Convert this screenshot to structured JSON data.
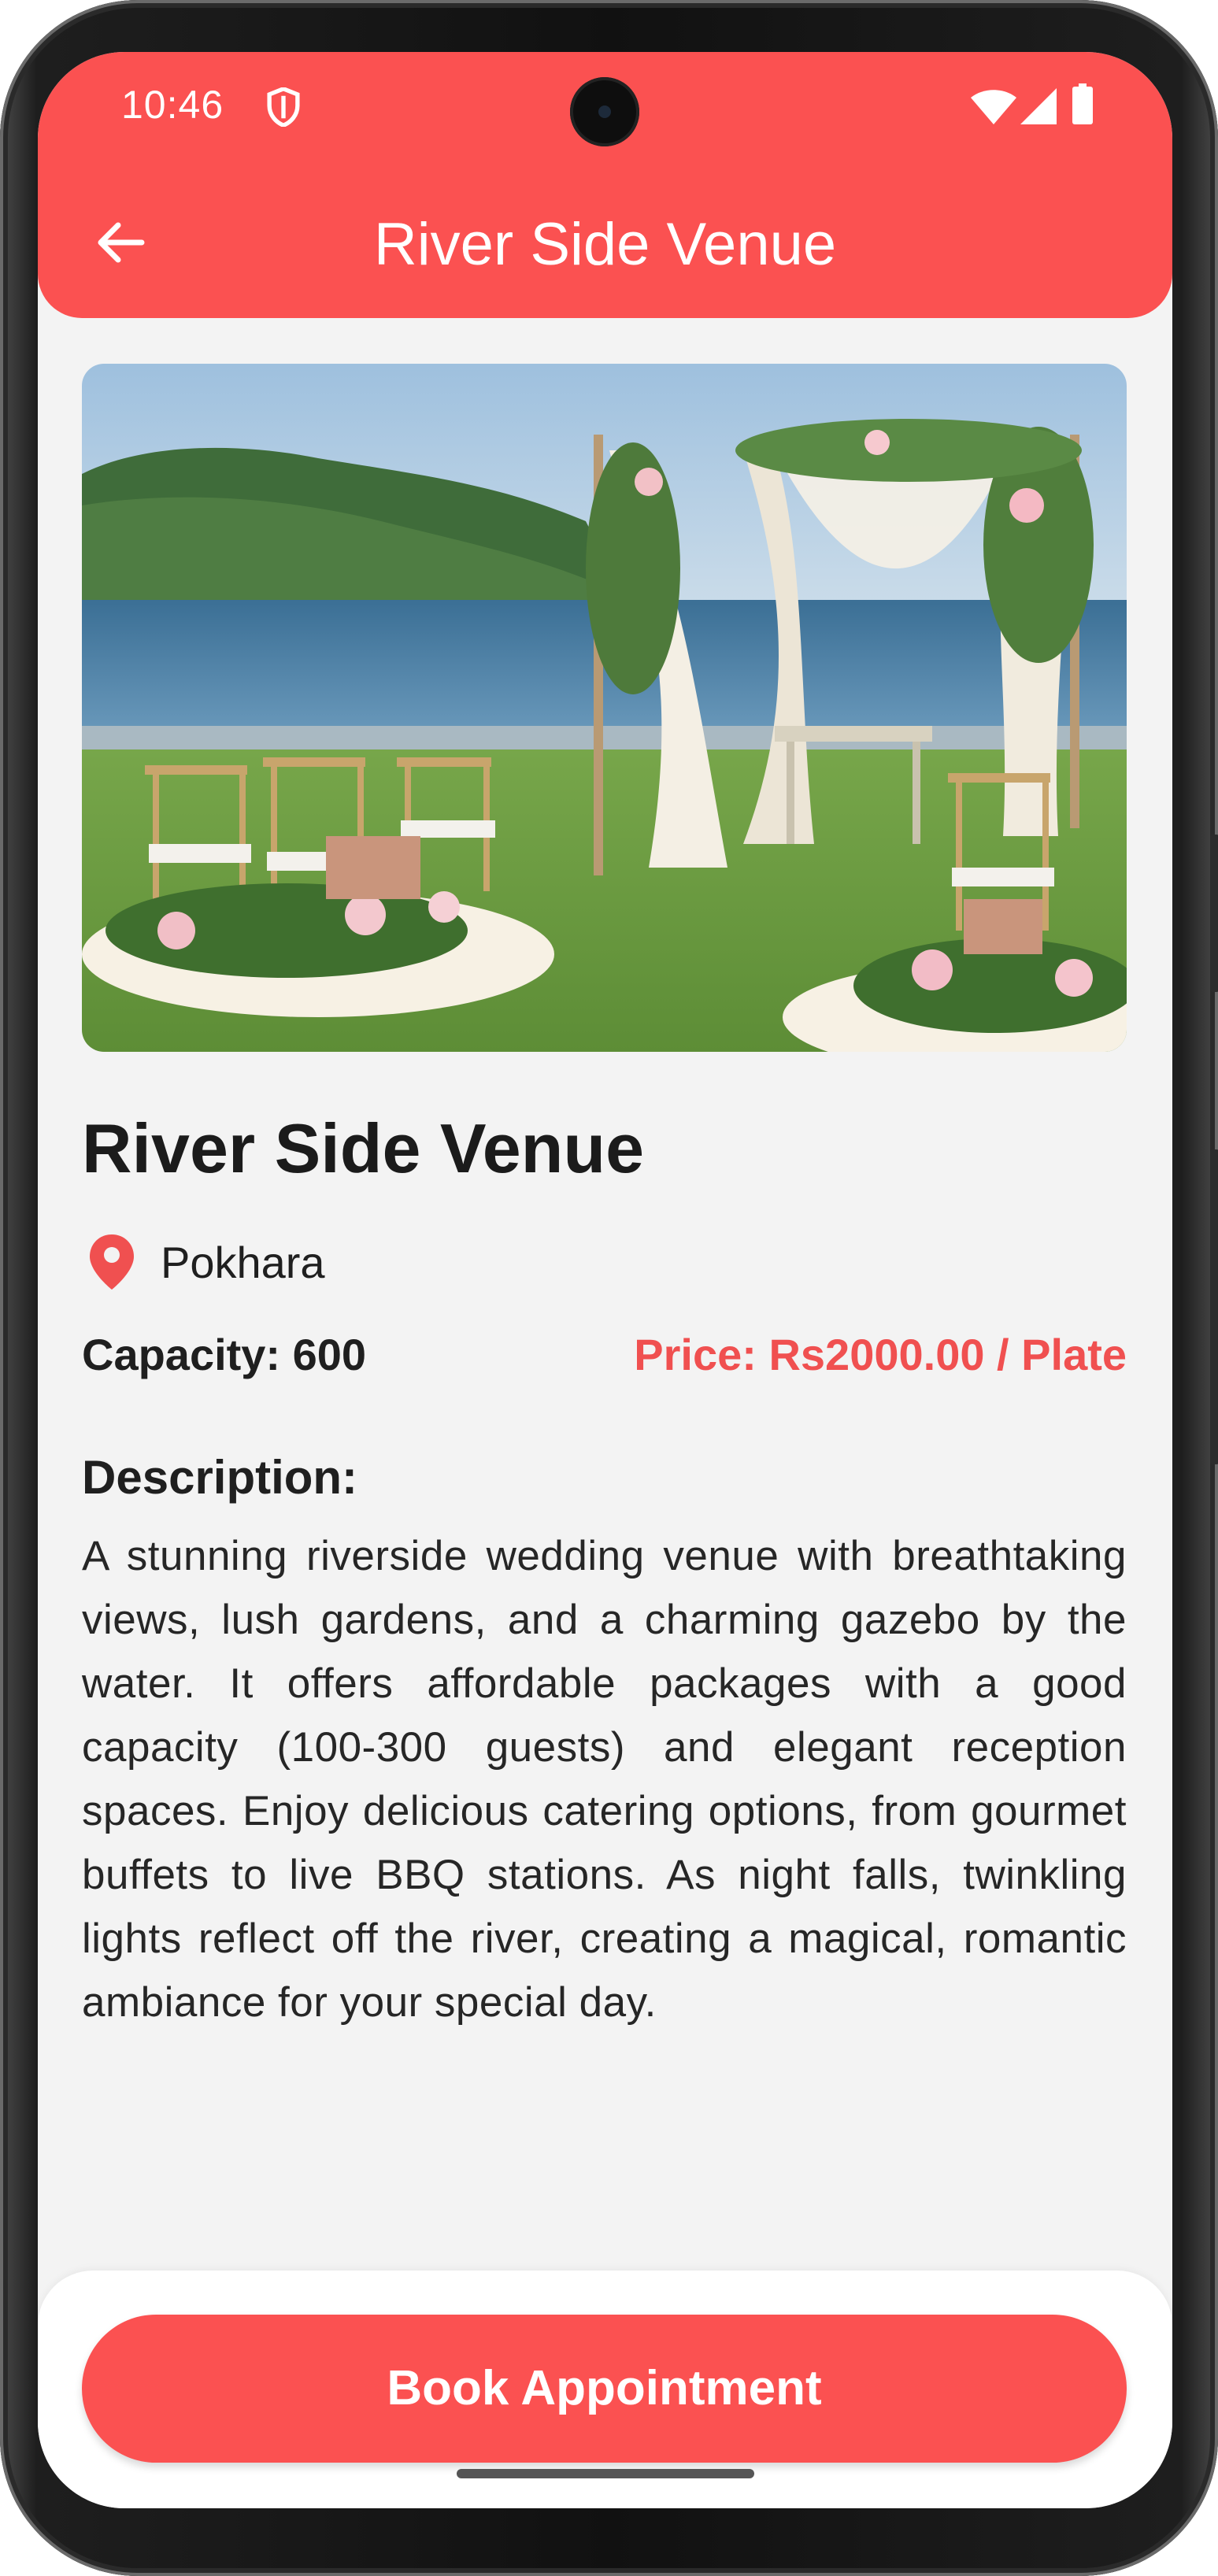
{
  "status_bar": {
    "time": "10:46",
    "icons": [
      "shield-icon",
      "wifi-icon",
      "signal-icon",
      "battery-icon"
    ]
  },
  "app_bar": {
    "title": "River Side Venue",
    "back_icon": "arrow-left-icon",
    "color": "#fb5151"
  },
  "venue": {
    "image_alt": "Outdoor wedding gazebo with white drapes and flowers by the water",
    "name": "River Side Venue",
    "location": "Pokhara",
    "capacity": "Capacity: 600",
    "price": "Price: Rs2000.00 / Plate",
    "description_label": "Description:",
    "description": "A stunning riverside wedding venue with breathtaking views, lush gardens, and a charming gazebo by the water. It offers affordable packages with a good capacity (100-300 guests) and elegant reception spaces. Enjoy delicious catering options, from gourmet buffets to live BBQ stations. As night falls, twinkling lights reflect off the river, creating a magical, romantic ambiance for your special day."
  },
  "actions": {
    "book_label": "Book Appointment"
  },
  "colors": {
    "accent": "#fb5151",
    "price_text": "#f05050",
    "background": "#f3f3f3"
  }
}
